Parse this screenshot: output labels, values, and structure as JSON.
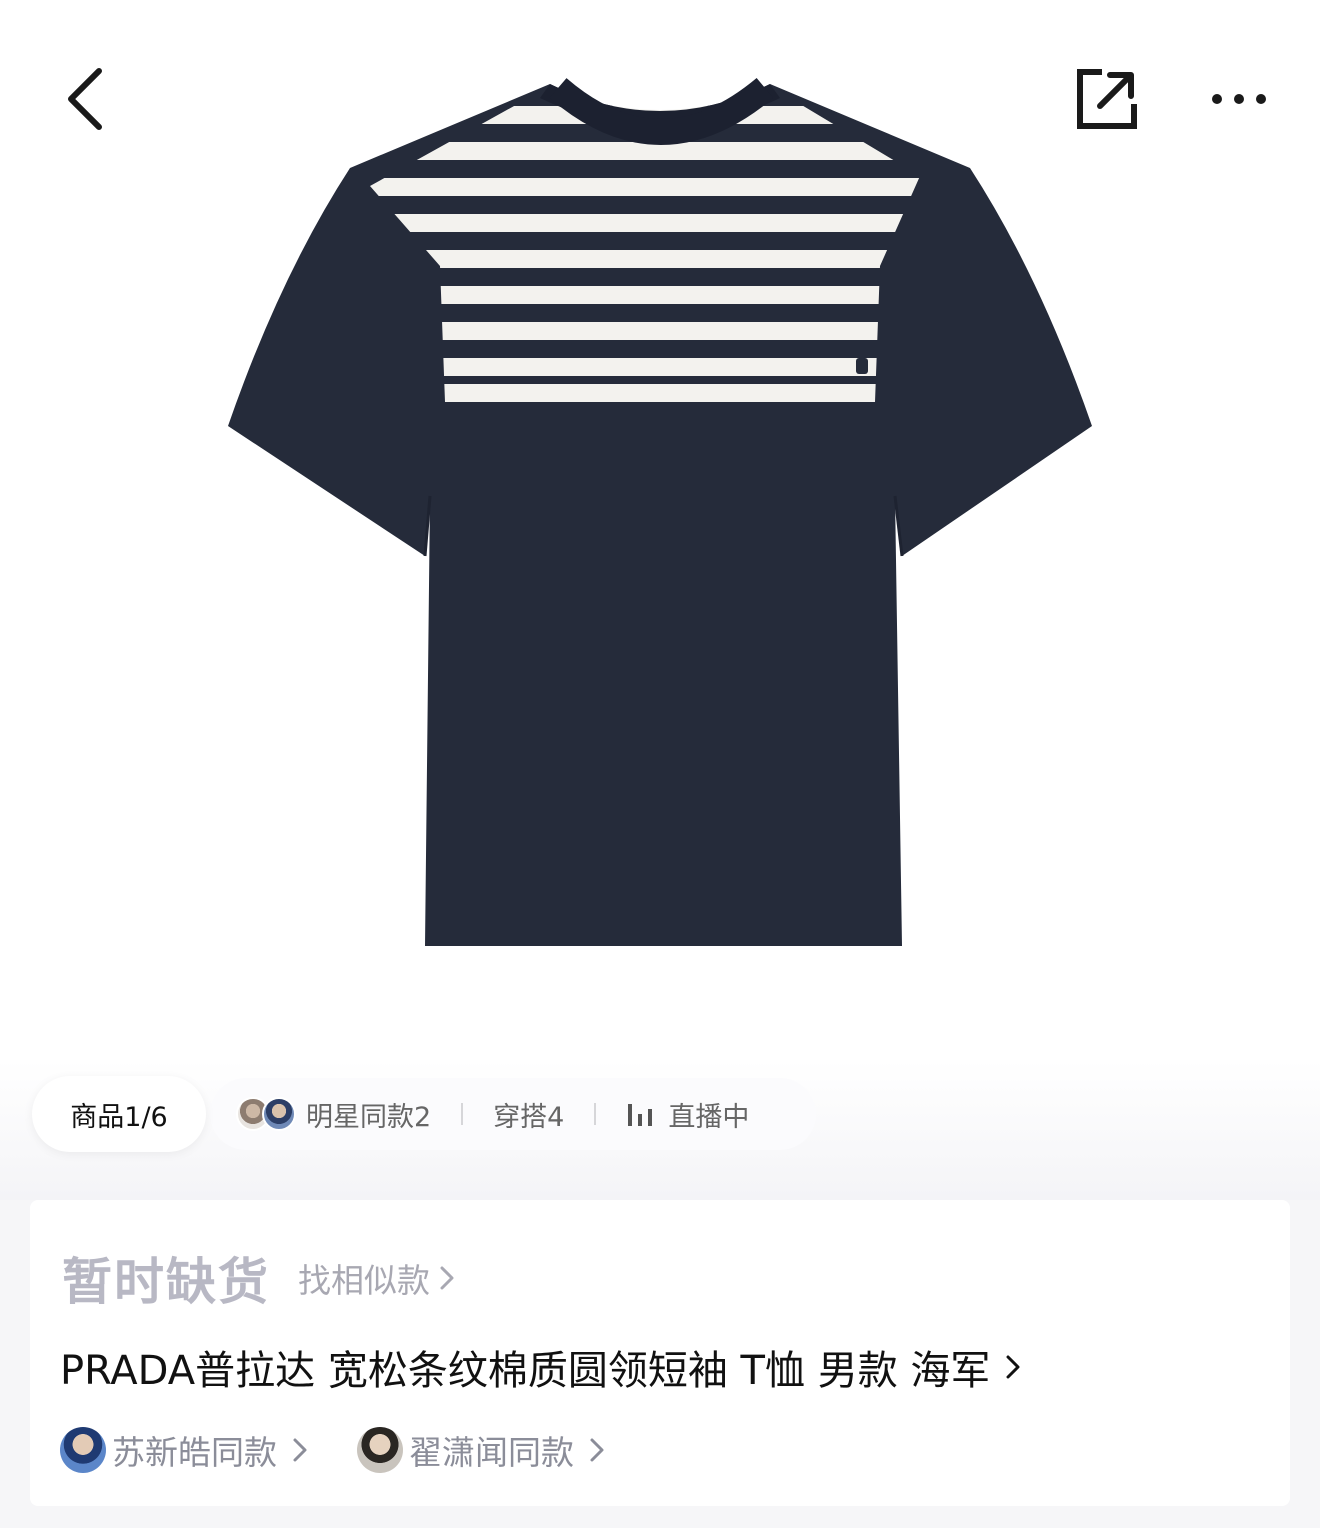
{
  "nav": {
    "back_icon": "chevron-left-icon",
    "share_icon": "share-icon",
    "more_icon": "more-icon"
  },
  "gallery": {
    "counter": "商品1/6",
    "tabs": [
      {
        "label": "明星同款2"
      },
      {
        "label": "穿搭4"
      },
      {
        "label": "直播中"
      }
    ]
  },
  "product": {
    "status": "暂时缺货",
    "find_similar": "找相似款",
    "title": "PRADA普拉达 宽松条纹棉质圆领短袖 T恤 男款 海军",
    "celebrities": [
      {
        "label": "苏新皓同款"
      },
      {
        "label": "翟潇闻同款"
      }
    ]
  },
  "colors": {
    "garment_navy": "#252b3a",
    "stripe_white": "#f3f2ee",
    "status_gray": "#b8b8c4",
    "muted_text": "#8b8d99"
  }
}
